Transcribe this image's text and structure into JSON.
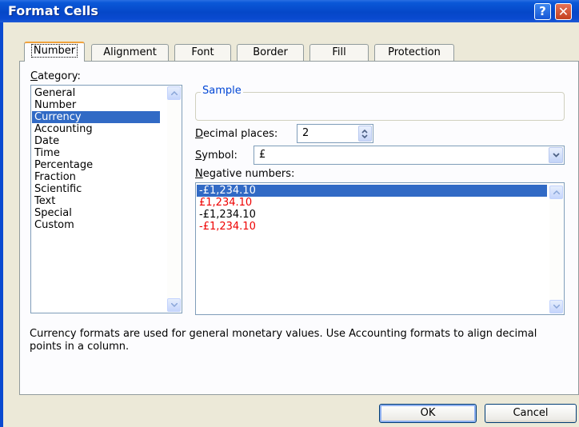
{
  "window": {
    "title": "Format Cells",
    "help_glyph": "?",
    "close_glyph": "✕"
  },
  "tabs": [
    {
      "label": "Number",
      "active": true
    },
    {
      "label": "Alignment"
    },
    {
      "label": "Font"
    },
    {
      "label": "Border"
    },
    {
      "label": "Fill"
    },
    {
      "label": "Protection"
    }
  ],
  "category": {
    "label_hotkey": "C",
    "label_rest": "ategory:",
    "items": [
      "General",
      "Number",
      "Currency",
      "Accounting",
      "Date",
      "Time",
      "Percentage",
      "Fraction",
      "Scientific",
      "Text",
      "Special",
      "Custom"
    ],
    "selected": "Currency"
  },
  "sample": {
    "legend": "Sample",
    "value": ""
  },
  "decimal_places": {
    "label_hotkey": "D",
    "label_rest": "ecimal places:",
    "value": "2"
  },
  "symbol": {
    "label_hotkey": "S",
    "label_rest": "ymbol:",
    "value": "£"
  },
  "negative_numbers": {
    "label_hotkey": "N",
    "label_rest": "egative numbers:",
    "items": [
      {
        "text": "-£1,234.10",
        "color": "#000000",
        "selected": true
      },
      {
        "text": "£1,234.10",
        "color": "#ee0000"
      },
      {
        "text": "-£1,234.10",
        "color": "#000000"
      },
      {
        "text": "-£1,234.10",
        "color": "#ee0000"
      }
    ]
  },
  "description": "Currency formats are used for general monetary values.  Use Accounting formats to align decimal points in a column.",
  "buttons": {
    "ok": "OK",
    "cancel": "Cancel"
  },
  "colors": {
    "titlebar": "#0a4ad0",
    "selection": "#316ac5",
    "negative_red": "#ee0000",
    "legend_blue": "#0046d5"
  }
}
